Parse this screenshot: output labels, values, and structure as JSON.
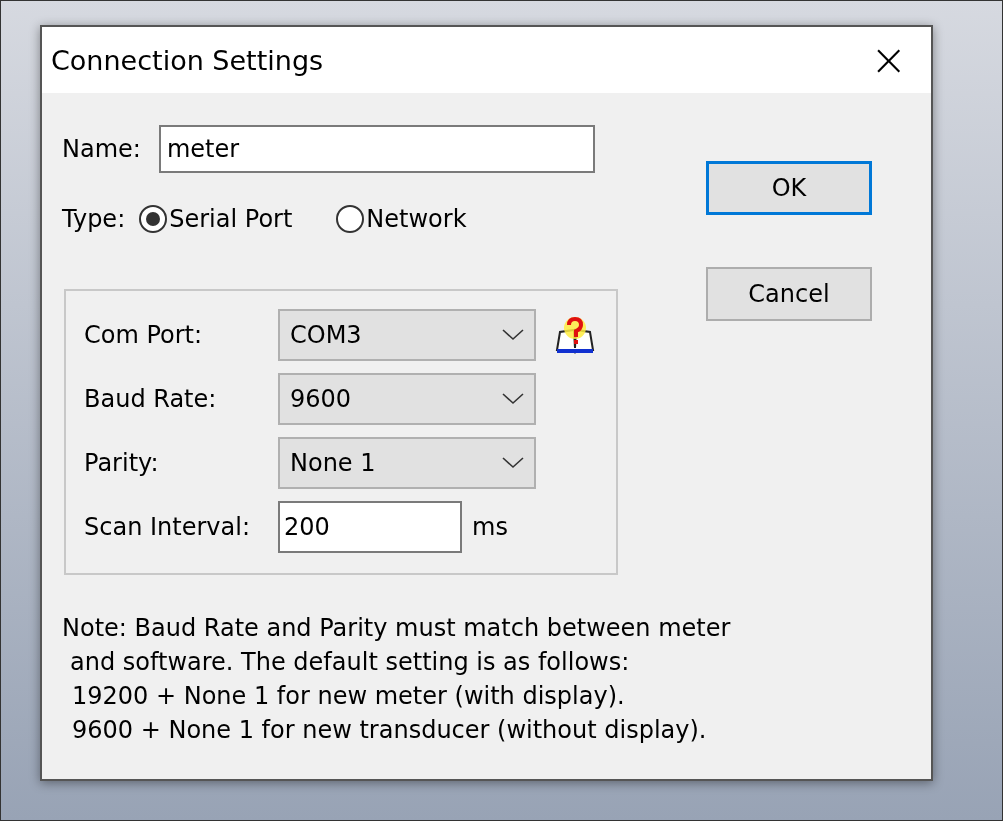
{
  "window": {
    "title": "Connection Settings",
    "close": "×"
  },
  "name_field": {
    "label": "Name:",
    "value": "meter"
  },
  "type": {
    "label": "Type:",
    "options": [
      {
        "label": "Serial Port",
        "selected": true
      },
      {
        "label": "Network",
        "selected": false
      }
    ]
  },
  "settings": [
    {
      "kind": "dropdown",
      "label": "Com Port:",
      "value": "COM3",
      "help": true
    },
    {
      "kind": "dropdown",
      "label": "Baud Rate:",
      "value": "9600",
      "help": false
    },
    {
      "kind": "dropdown",
      "label": "Parity:",
      "value": "None 1",
      "help": false
    },
    {
      "kind": "input",
      "label": "Scan Interval:",
      "value": "200",
      "unit": "ms",
      "help": false
    }
  ],
  "note": [
    "Note:  Baud Rate and Parity must match between meter",
    "and software. The default setting is as follows:",
    "19200 + None 1 for new meter (with display).",
    "9600 + None 1 for new transducer (without display)."
  ],
  "buttons": [
    {
      "label": "OK",
      "default": true
    },
    {
      "label": "Cancel",
      "default": false
    }
  ]
}
